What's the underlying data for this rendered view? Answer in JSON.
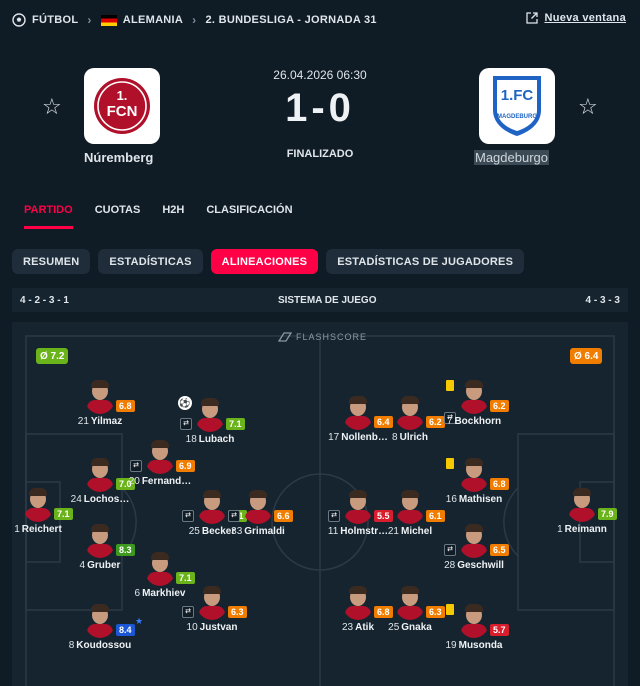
{
  "breadcrumb": {
    "sport": "FÚTBOL",
    "country": "ALEMANIA",
    "league": "2. BUNDESLIGA - JORNADA 31"
  },
  "new_window": "Nueva ventana",
  "match": {
    "datetime": "26.04.2026 06:30",
    "score": "1-0",
    "status": "FINALIZADO",
    "home": {
      "name": "Núremberg",
      "logo_text": "1.FCN",
      "logo_top": "1."
    },
    "away": {
      "name": "Magdeburgo",
      "logo_text": "1.FC",
      "logo_sub": "MAGDEBURG"
    }
  },
  "tabs": [
    "PARTIDO",
    "CUOTAS",
    "H2H",
    "CLASIFICACIÓN"
  ],
  "pills": [
    "RESUMEN",
    "ESTADÍSTICAS",
    "ALINEACIONES",
    "ESTADÍSTICAS DE JUGADORES"
  ],
  "system": {
    "home": "4 - 2 - 3 - 1",
    "label": "SISTEMA DE JUEGO",
    "away": "4 - 3 - 3"
  },
  "brand": "FLASHSCORE",
  "averages": {
    "home": "Ø 7.2",
    "away": "Ø 6.4"
  },
  "colors": {
    "accent": "#ff0046",
    "green": "#3d9a1e",
    "lightgreen": "#6ab31a",
    "orange": "#f07d00",
    "red": "#d81e2d",
    "blue": "#1a56d6"
  },
  "players": [
    {
      "num": "1",
      "name": "Reichert",
      "rating": "7.1",
      "color": "lightgreen",
      "icons": []
    },
    {
      "num": "24",
      "name": "Lochos…",
      "rating": "7.0",
      "color": "lightgreen",
      "icons": []
    },
    {
      "num": "21",
      "name": "Yilmaz",
      "rating": "6.8",
      "color": "orange",
      "icons": []
    },
    {
      "num": "4",
      "name": "Gruber",
      "rating": "8.3",
      "color": "green",
      "icons": []
    },
    {
      "num": "8",
      "name": "Koudossou",
      "rating": "8.4",
      "color": "blue",
      "icons": [
        "star"
      ]
    },
    {
      "num": "20",
      "name": "Fernand…",
      "rating": "6.9",
      "color": "orange",
      "icons": [
        "sub"
      ]
    },
    {
      "num": "6",
      "name": "Markhiev",
      "rating": "7.1",
      "color": "lightgreen",
      "icons": []
    },
    {
      "num": "18",
      "name": "Lubach",
      "rating": "7.1",
      "color": "lightgreen",
      "icons": [
        "ball",
        "sub"
      ]
    },
    {
      "num": "25",
      "name": "Becker",
      "rating": "7.1",
      "color": "lightgreen",
      "icons": [
        "sub"
      ]
    },
    {
      "num": "10",
      "name": "Justvan",
      "rating": "6.3",
      "color": "orange",
      "icons": [
        "sub"
      ]
    },
    {
      "num": "33",
      "name": "Grimaldi",
      "rating": "6.6",
      "color": "orange",
      "icons": [
        "sub"
      ]
    },
    {
      "num": "17",
      "name": "Nollenb…",
      "rating": "6.4",
      "color": "orange",
      "icons": []
    },
    {
      "num": "11",
      "name": "Holmstr…",
      "rating": "5.5",
      "color": "red",
      "icons": [
        "sub"
      ]
    },
    {
      "num": "23",
      "name": "Atik",
      "rating": "6.8",
      "color": "orange",
      "icons": []
    },
    {
      "num": "8",
      "name": "Ulrich",
      "rating": "6.2",
      "color": "orange",
      "icons": []
    },
    {
      "num": "21",
      "name": "Michel",
      "rating": "6.1",
      "color": "orange",
      "icons": []
    },
    {
      "num": "25",
      "name": "Gnaka",
      "rating": "6.3",
      "color": "orange",
      "icons": []
    },
    {
      "num": "7",
      "name": "Bockhorn",
      "rating": "6.2",
      "color": "orange",
      "icons": [
        "yellow",
        "sub"
      ]
    },
    {
      "num": "16",
      "name": "Mathisen",
      "rating": "6.8",
      "color": "orange",
      "icons": [
        "yellow"
      ]
    },
    {
      "num": "28",
      "name": "Geschwill",
      "rating": "6.5",
      "color": "orange",
      "icons": [
        "sub"
      ]
    },
    {
      "num": "19",
      "name": "Musonda",
      "rating": "5.7",
      "color": "red",
      "icons": [
        "yellow"
      ]
    },
    {
      "num": "1",
      "name": "Reimann",
      "rating": "7.9",
      "color": "lightgreen",
      "icons": []
    }
  ]
}
